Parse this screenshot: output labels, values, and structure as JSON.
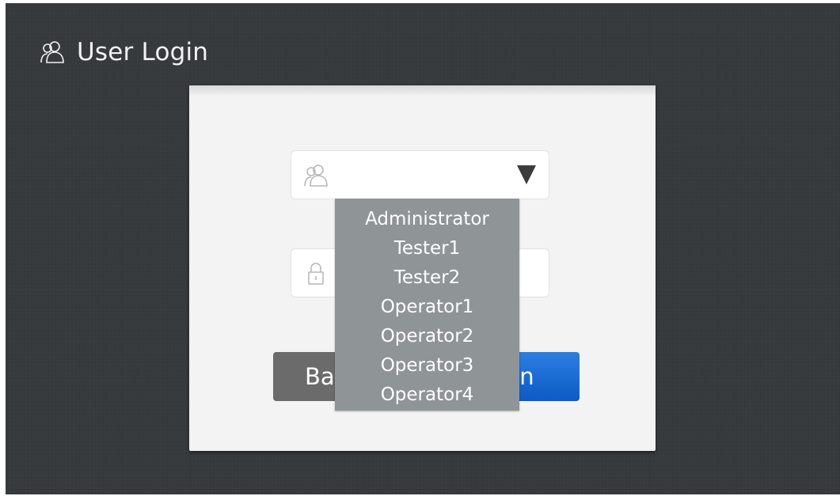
{
  "header": {
    "title": "User Login",
    "icon": "users-icon"
  },
  "login_form": {
    "user_select": {
      "selected": "",
      "icon": "users-icon",
      "caret_icon": "triangle-down-icon"
    },
    "password_field": {
      "value": "",
      "icon": "lock-icon"
    },
    "back_label": "Back",
    "login_label": "Login"
  },
  "user_dropdown": {
    "options": [
      "Administrator",
      "Tester1",
      "Tester2",
      "Operator1",
      "Operator2",
      "Operator3",
      "Operator4"
    ]
  },
  "colors": {
    "background": "#35393c",
    "card": "#f3f3f3",
    "dropdown": "#8f9597",
    "login_button": "#1a6ed6",
    "back_button": "#6b6b6b"
  }
}
